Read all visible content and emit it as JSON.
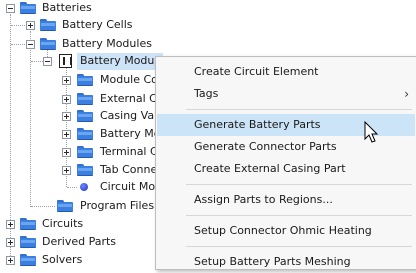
{
  "tree": {
    "batteries": "Batteries",
    "battery_cells": "Battery Cells",
    "battery_modules": "Battery Modules",
    "battery_module": "Battery Modul",
    "children": [
      "Module Co",
      "External Ca",
      "Casing Val",
      "Battery Mo",
      "Terminal C",
      "Tab Conne",
      "Circuit Mo"
    ],
    "program_files": "Program Files",
    "circuits": "Circuits",
    "derived_parts": "Derived Parts",
    "solvers": "Solvers"
  },
  "context_menu": {
    "items": [
      "Create Circuit Element",
      "Tags",
      "Generate Battery Parts",
      "Generate Connector Parts",
      "Create External Casing Part",
      "Assign Parts to Regions...",
      "Setup Connector Ohmic Heating",
      "Setup Battery Parts Meshing"
    ],
    "submenu_arrow": "›",
    "highlighted_index": 2
  },
  "colors": {
    "folder": "#3b7fe0",
    "selection": "#cde3f7",
    "menu_highlight": "#cce4f7"
  }
}
